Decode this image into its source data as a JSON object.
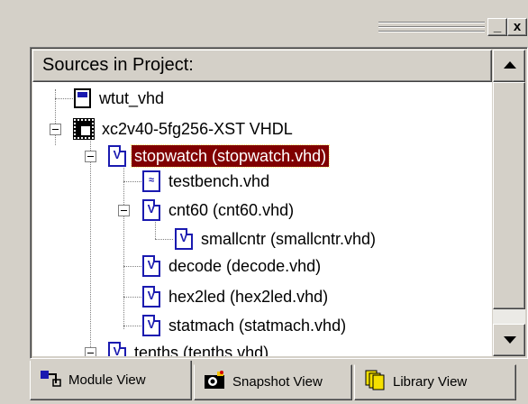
{
  "window": {
    "minimize_label": "_",
    "close_label": "x"
  },
  "panel": {
    "header_title": "Sources in Project:"
  },
  "tree": {
    "items": [
      {
        "label": "wtut_vhd",
        "icon": "project-file-icon"
      },
      {
        "label": "xc2v40-5fg256-XST VHDL",
        "icon": "chip-icon"
      },
      {
        "label": "stopwatch (stopwatch.vhd)",
        "icon": "vhdl-file-icon",
        "selected": true
      },
      {
        "label": "testbench.vhd",
        "icon": "testbench-file-icon"
      },
      {
        "label": "cnt60 (cnt60.vhd)",
        "icon": "vhdl-file-icon"
      },
      {
        "label": "smallcntr (smallcntr.vhd)",
        "icon": "vhdl-file-icon"
      },
      {
        "label": "decode (decode.vhd)",
        "icon": "vhdl-file-icon"
      },
      {
        "label": "hex2led (hex2led.vhd)",
        "icon": "vhdl-file-icon"
      },
      {
        "label": "statmach (statmach.vhd)",
        "icon": "vhdl-file-icon"
      },
      {
        "label": "tenths (tenths.vhd)",
        "icon": "vhdl-file-icon"
      }
    ],
    "selection_color": "#800000",
    "icon_letter": "V"
  },
  "tabs": [
    {
      "label": "Module View",
      "icon": "module-view-icon",
      "active": true
    },
    {
      "label": "Snapshot View",
      "icon": "camera-icon",
      "active": false
    },
    {
      "label": "Library View",
      "icon": "library-icon",
      "active": false
    }
  ]
}
